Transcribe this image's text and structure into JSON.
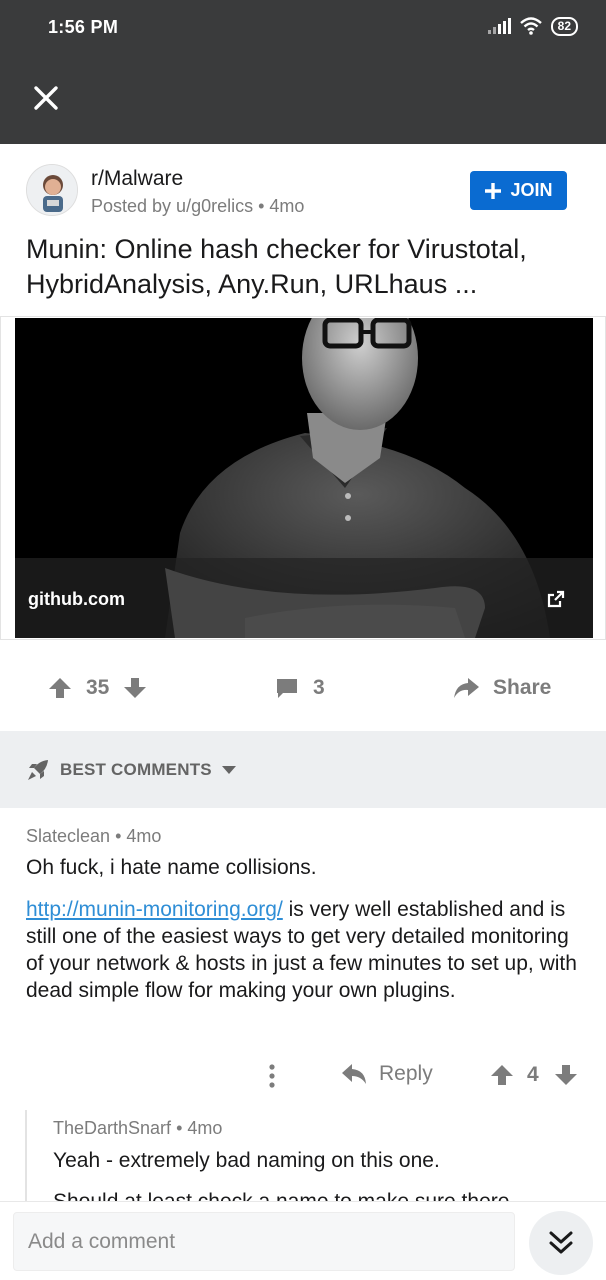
{
  "status_bar": {
    "time": "1:56 PM",
    "battery": "82",
    "icons": [
      "signal-icon",
      "wifi-icon",
      "battery-icon"
    ]
  },
  "app_bar": {
    "close_icon": "close-icon"
  },
  "post": {
    "subreddit": "r/Malware",
    "posted_by": "Posted by u/g0relics",
    "age": "4mo",
    "join_label": "JOIN",
    "title": "Munin: Online hash checker for Virustotal, HybridAnalysis, Any.Run, URLhaus ...",
    "link_domain": "github.com",
    "score": "35",
    "comment_count": "3",
    "share_label": "Share"
  },
  "sort": {
    "label": "BEST COMMENTS"
  },
  "comments": [
    {
      "author": "Slateclean",
      "age": "4mo",
      "paragraph1": "Oh fuck, i hate name collisions.",
      "link": "http://munin-monitoring.org/",
      "paragraph2_rest": " is very well established and is still one of the easiest ways to get very detailed monitoring of your network & hosts in just a few minutes to set up, with dead simple flow for making your own plugins.",
      "reply_label": "Reply",
      "score": "4"
    },
    {
      "author": "TheDarthSnarf",
      "age": "4mo",
      "paragraph1": "Yeah - extremely bad naming on this one.",
      "paragraph2": "Should at least check a name to make sure there"
    }
  ],
  "composer": {
    "placeholder": "Add a comment"
  },
  "colors": {
    "header_bg": "#3a3b3c",
    "join_blue": "#0a6bd1",
    "link_blue": "#2f8ed6",
    "meta_gray": "#7c7c7c",
    "sort_bg": "#edeff1"
  }
}
